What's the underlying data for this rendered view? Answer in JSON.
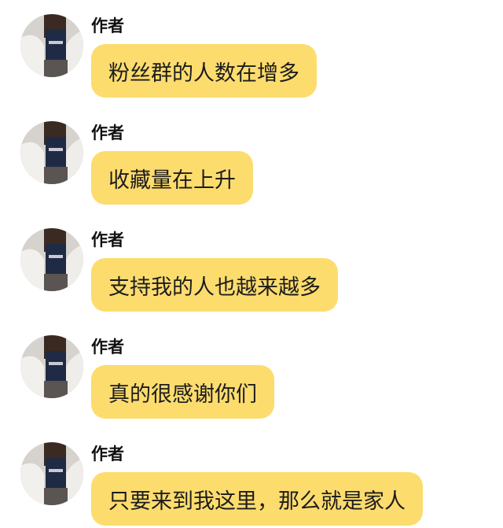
{
  "colors": {
    "bubble": "#fddc6e",
    "text": "#1c1c1c",
    "background": "#ffffff"
  },
  "messages": [
    {
      "sender": "作者",
      "text": "粉丝群的人数在增多",
      "avatar_icon": "user-avatar-photo"
    },
    {
      "sender": "作者",
      "text": "收藏量在上升",
      "avatar_icon": "user-avatar-photo"
    },
    {
      "sender": "作者",
      "text": "支持我的人也越来越多",
      "avatar_icon": "user-avatar-photo"
    },
    {
      "sender": "作者",
      "text": "真的很感谢你们",
      "avatar_icon": "user-avatar-photo"
    },
    {
      "sender": "作者",
      "text": "只要来到我这里，那么就是家人",
      "avatar_icon": "user-avatar-photo"
    }
  ]
}
